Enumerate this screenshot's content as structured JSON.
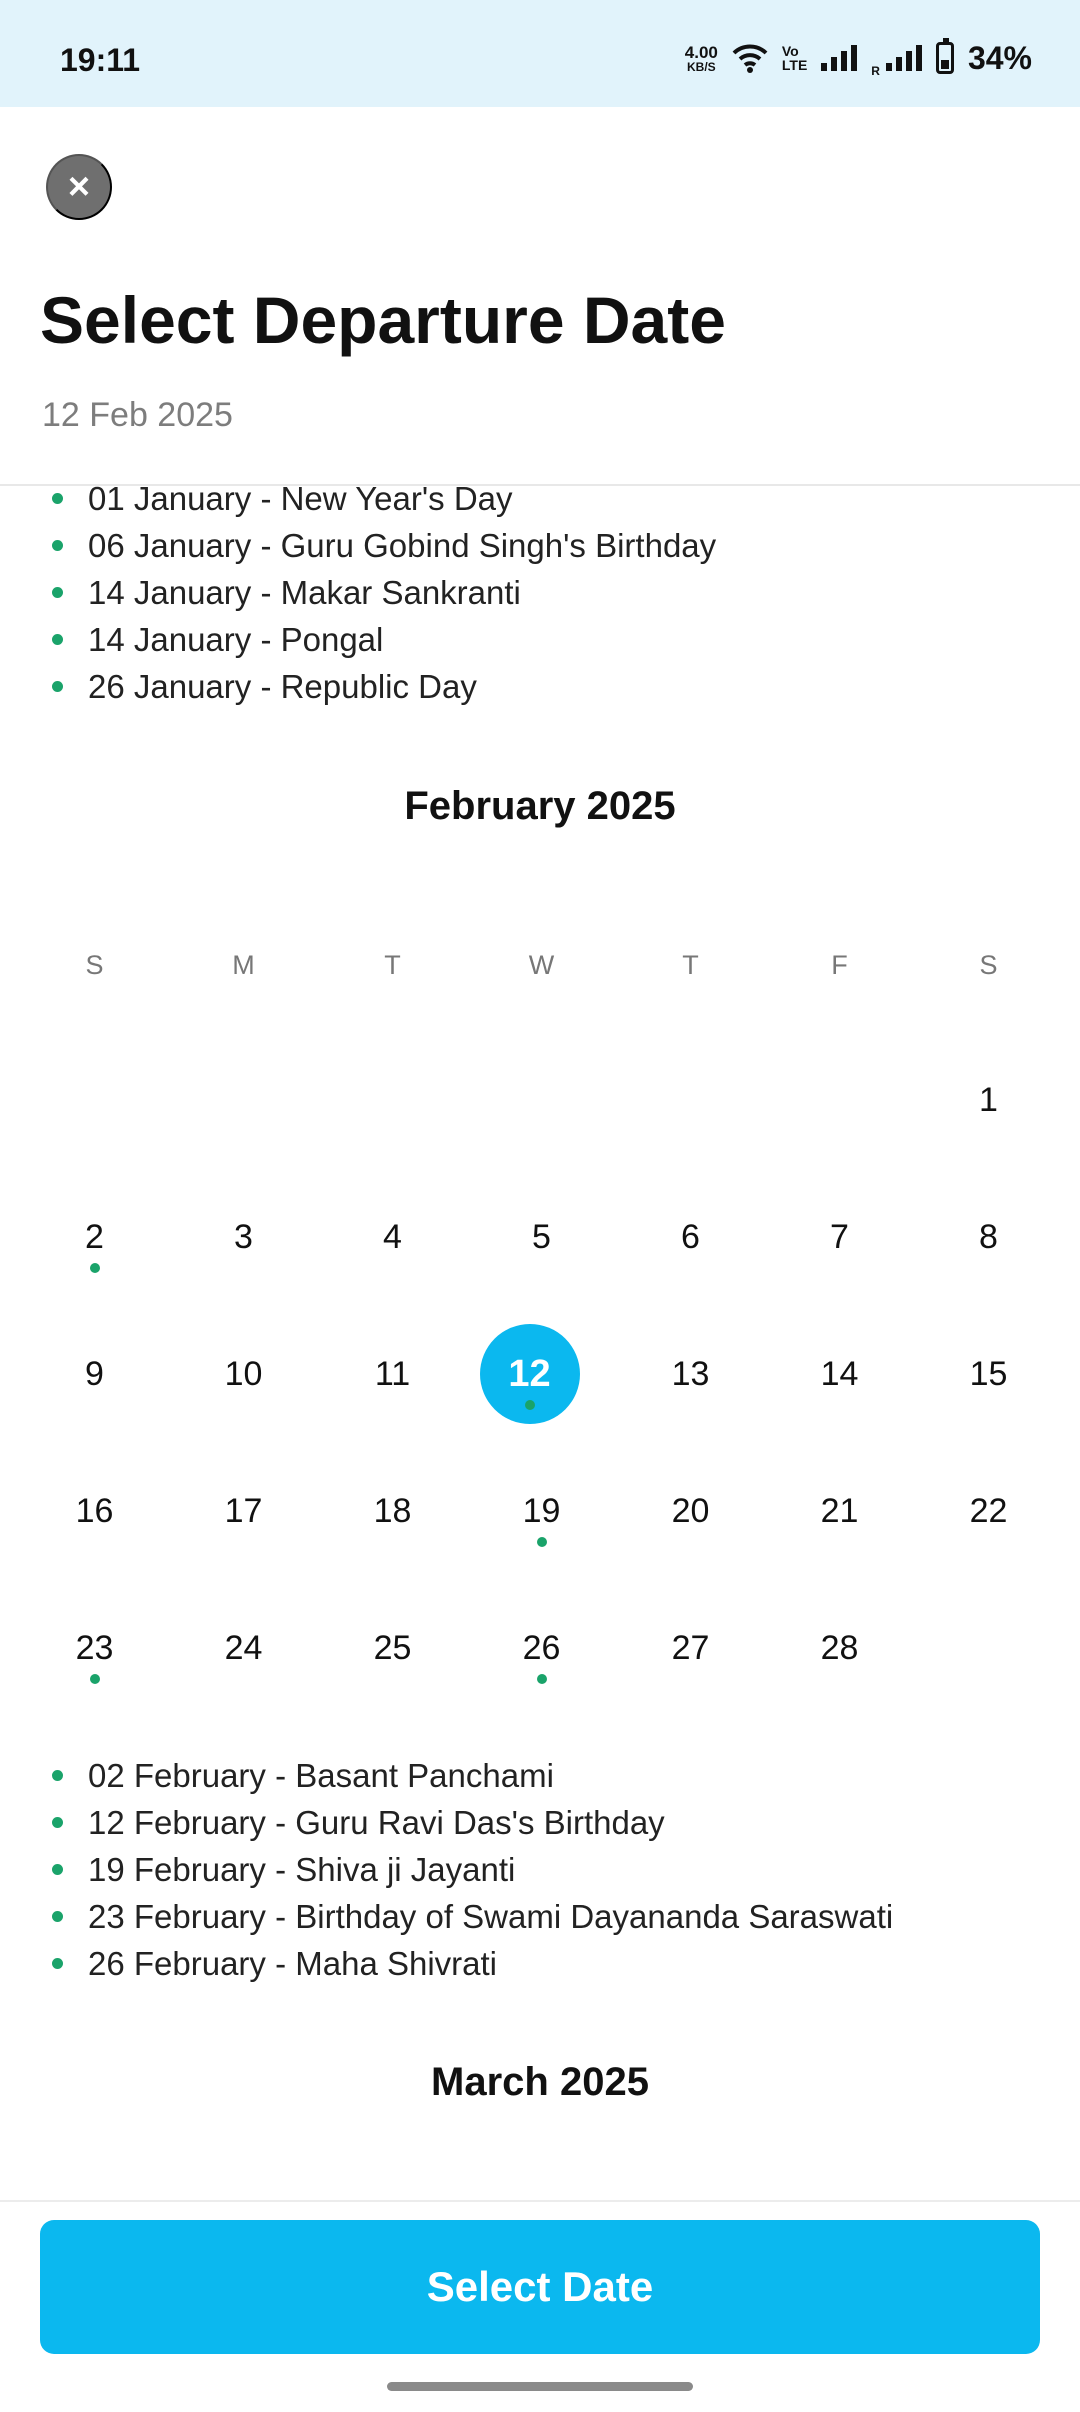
{
  "status_bar": {
    "time": "19:11",
    "speed_value": "4.00",
    "speed_unit": "KB/S",
    "volte_top": "Vo",
    "volte_bottom": "LTE",
    "roaming": "R",
    "battery": "34%"
  },
  "header": {
    "close_icon": "×",
    "title": "Select Departure Date",
    "selected_date": "12 Feb 2025"
  },
  "january_holidays": [
    "01 January - New Year's Day",
    "06 January - Guru Gobind Singh's Birthday",
    "14 January - Makar Sankranti",
    "14 January - Pongal",
    "26 January - Republic Day"
  ],
  "february": {
    "title": "February 2025",
    "weekdays": [
      "S",
      "M",
      "T",
      "W",
      "T",
      "F",
      "S"
    ],
    "days": [
      "1",
      "2",
      "3",
      "4",
      "5",
      "6",
      "7",
      "8",
      "9",
      "10",
      "11",
      "12",
      "13",
      "14",
      "15",
      "16",
      "17",
      "18",
      "19",
      "20",
      "21",
      "22",
      "23",
      "24",
      "25",
      "26",
      "27",
      "28"
    ],
    "holiday_days": [
      2,
      12,
      19,
      23,
      26
    ],
    "selected_day": 12,
    "holidays": [
      "02 February - Basant Panchami",
      "12 February - Guru Ravi Das's Birthday",
      "19 February - Shiva ji Jayanti",
      "23 February - Birthday of Swami Dayananda Saraswati",
      "26 February - Maha Shivrati"
    ]
  },
  "march": {
    "title": "March 2025"
  },
  "footer": {
    "select_label": "Select Date"
  },
  "colors": {
    "accent": "#0bb8ef",
    "holiday_dot": "#1aa36a",
    "status_bar_bg": "#e1f3fb"
  }
}
